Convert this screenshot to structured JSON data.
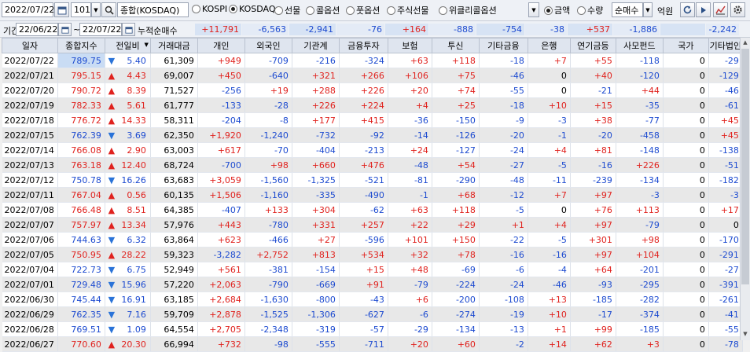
{
  "toolbar": {
    "date_value": "2022/07/22",
    "market_code": "101",
    "market_name": "종합(KOSDAQ)",
    "radios": [
      {
        "label": "KOSPI",
        "checked": false
      },
      {
        "label": "KOSDAQ",
        "checked": true
      },
      {
        "label": "선물",
        "checked": false
      },
      {
        "label": "콜옵션",
        "checked": false
      },
      {
        "label": "풋옵션",
        "checked": false
      },
      {
        "label": "주식선물",
        "checked": false
      },
      {
        "label": "위클리콜옵션",
        "checked": false
      }
    ],
    "amount_radios": [
      {
        "label": "금액",
        "checked": true
      },
      {
        "label": "수량",
        "checked": false
      }
    ],
    "mode_select": "순매수",
    "unit": "억원"
  },
  "period": {
    "label": "기간",
    "from": "22/06/22",
    "to": "22/07/22",
    "sum_label": "누적순매수",
    "sums": [
      "+11,791",
      "-6,563",
      "-2,941",
      "-76",
      "+164",
      "-888",
      "-754",
      "-38",
      "+537",
      "-1,886",
      "",
      "-2,242"
    ]
  },
  "columns": [
    "일자",
    "종합지수",
    "전일비",
    "거래대금",
    "개인",
    "외국인",
    "기관계",
    "금융투자",
    "보험",
    "투신",
    "기타금융",
    "은행",
    "연기금등",
    "사모펀드",
    "국가",
    "기타법인"
  ],
  "rows": [
    {
      "date": "2022/07/22",
      "index": "789.75",
      "dir": "down",
      "change": "5.40",
      "volume": "61,309",
      "vals": [
        "+949",
        "-709",
        "-216",
        "-324",
        "+63",
        "+118",
        "-18",
        "+7",
        "+55",
        "-118",
        "0",
        "-29"
      ]
    },
    {
      "date": "2022/07/21",
      "index": "795.15",
      "dir": "up",
      "change": "4.43",
      "volume": "69,007",
      "vals": [
        "+450",
        "-640",
        "+321",
        "+266",
        "+106",
        "+75",
        "-46",
        "0",
        "+40",
        "-120",
        "0",
        "-129"
      ]
    },
    {
      "date": "2022/07/20",
      "index": "790.72",
      "dir": "up",
      "change": "8.39",
      "volume": "71,527",
      "vals": [
        "-256",
        "+19",
        "+288",
        "+226",
        "+20",
        "+74",
        "-55",
        "0",
        "-21",
        "+44",
        "0",
        "-46"
      ]
    },
    {
      "date": "2022/07/19",
      "index": "782.33",
      "dir": "up",
      "change": "5.61",
      "volume": "61,777",
      "vals": [
        "-133",
        "-28",
        "+226",
        "+224",
        "+4",
        "+25",
        "-18",
        "+10",
        "+15",
        "-35",
        "0",
        "-61"
      ]
    },
    {
      "date": "2022/07/18",
      "index": "776.72",
      "dir": "up",
      "change": "14.33",
      "volume": "58,311",
      "vals": [
        "-204",
        "-8",
        "+177",
        "+415",
        "-36",
        "-150",
        "-9",
        "-3",
        "+38",
        "-77",
        "0",
        "+45"
      ]
    },
    {
      "date": "2022/07/15",
      "index": "762.39",
      "dir": "down",
      "change": "3.69",
      "volume": "62,350",
      "vals": [
        "+1,920",
        "-1,240",
        "-732",
        "-92",
        "-14",
        "-126",
        "-20",
        "-1",
        "-20",
        "-458",
        "0",
        "+45"
      ]
    },
    {
      "date": "2022/07/14",
      "index": "766.08",
      "dir": "up",
      "change": "2.90",
      "volume": "63,003",
      "vals": [
        "+617",
        "-70",
        "-404",
        "-213",
        "+24",
        "-127",
        "-24",
        "+4",
        "+81",
        "-148",
        "0",
        "-138"
      ]
    },
    {
      "date": "2022/07/13",
      "index": "763.18",
      "dir": "up",
      "change": "12.40",
      "volume": "68,724",
      "vals": [
        "-700",
        "+98",
        "+660",
        "+476",
        "-48",
        "+54",
        "-27",
        "-5",
        "-16",
        "+226",
        "0",
        "-51"
      ]
    },
    {
      "date": "2022/07/12",
      "index": "750.78",
      "dir": "down",
      "change": "16.26",
      "volume": "63,683",
      "vals": [
        "+3,059",
        "-1,560",
        "-1,325",
        "-521",
        "-81",
        "-290",
        "-48",
        "-11",
        "-239",
        "-134",
        "0",
        "-182"
      ]
    },
    {
      "date": "2022/07/11",
      "index": "767.04",
      "dir": "up",
      "change": "0.56",
      "volume": "60,135",
      "vals": [
        "+1,506",
        "-1,160",
        "-335",
        "-490",
        "-1",
        "+68",
        "-12",
        "+7",
        "+97",
        "-3",
        "0",
        "-3"
      ]
    },
    {
      "date": "2022/07/08",
      "index": "766.48",
      "dir": "up",
      "change": "8.51",
      "volume": "64,385",
      "vals": [
        "-407",
        "+133",
        "+304",
        "-62",
        "+63",
        "+118",
        "-5",
        "0",
        "+76",
        "+113",
        "0",
        "+17"
      ]
    },
    {
      "date": "2022/07/07",
      "index": "757.97",
      "dir": "up",
      "change": "13.34",
      "volume": "57,976",
      "vals": [
        "+443",
        "-780",
        "+331",
        "+257",
        "+22",
        "+29",
        "+1",
        "+4",
        "+97",
        "-79",
        "0",
        "0"
      ]
    },
    {
      "date": "2022/07/06",
      "index": "744.63",
      "dir": "down",
      "change": "6.32",
      "volume": "63,864",
      "vals": [
        "+623",
        "-466",
        "+27",
        "-596",
        "+101",
        "+150",
        "-22",
        "-5",
        "+301",
        "+98",
        "0",
        "-170"
      ]
    },
    {
      "date": "2022/07/05",
      "index": "750.95",
      "dir": "up",
      "change": "28.22",
      "volume": "59,323",
      "vals": [
        "-3,282",
        "+2,752",
        "+813",
        "+534",
        "+32",
        "+78",
        "-16",
        "-16",
        "+97",
        "+104",
        "0",
        "-291"
      ]
    },
    {
      "date": "2022/07/04",
      "index": "722.73",
      "dir": "down",
      "change": "6.75",
      "volume": "52,949",
      "vals": [
        "+561",
        "-381",
        "-154",
        "+15",
        "+48",
        "-69",
        "-6",
        "-4",
        "+64",
        "-201",
        "0",
        "-27"
      ]
    },
    {
      "date": "2022/07/01",
      "index": "729.48",
      "dir": "down",
      "change": "15.96",
      "volume": "57,220",
      "vals": [
        "+2,063",
        "-790",
        "-669",
        "+91",
        "-79",
        "-224",
        "-24",
        "-46",
        "-93",
        "-295",
        "0",
        "-391"
      ]
    },
    {
      "date": "2022/06/30",
      "index": "745.44",
      "dir": "down",
      "change": "16.91",
      "volume": "63,185",
      "vals": [
        "+2,684",
        "-1,630",
        "-800",
        "-43",
        "+6",
        "-200",
        "-108",
        "+13",
        "-185",
        "-282",
        "0",
        "-261"
      ]
    },
    {
      "date": "2022/06/29",
      "index": "762.35",
      "dir": "down",
      "change": "7.16",
      "volume": "59,709",
      "vals": [
        "+2,878",
        "-1,525",
        "-1,306",
        "-627",
        "-6",
        "-274",
        "-19",
        "+10",
        "-17",
        "-374",
        "0",
        "-41"
      ]
    },
    {
      "date": "2022/06/28",
      "index": "769.51",
      "dir": "down",
      "change": "1.09",
      "volume": "64,554",
      "vals": [
        "+2,705",
        "-2,348",
        "-319",
        "-57",
        "-29",
        "-134",
        "-13",
        "+1",
        "+99",
        "-185",
        "0",
        "-55"
      ]
    },
    {
      "date": "2022/06/27",
      "index": "770.60",
      "dir": "up",
      "change": "20.30",
      "volume": "66,994",
      "vals": [
        "+732",
        "-98",
        "-555",
        "-711",
        "+20",
        "+60",
        "-2",
        "+14",
        "+62",
        "+3",
        "0",
        "-78"
      ]
    }
  ]
}
